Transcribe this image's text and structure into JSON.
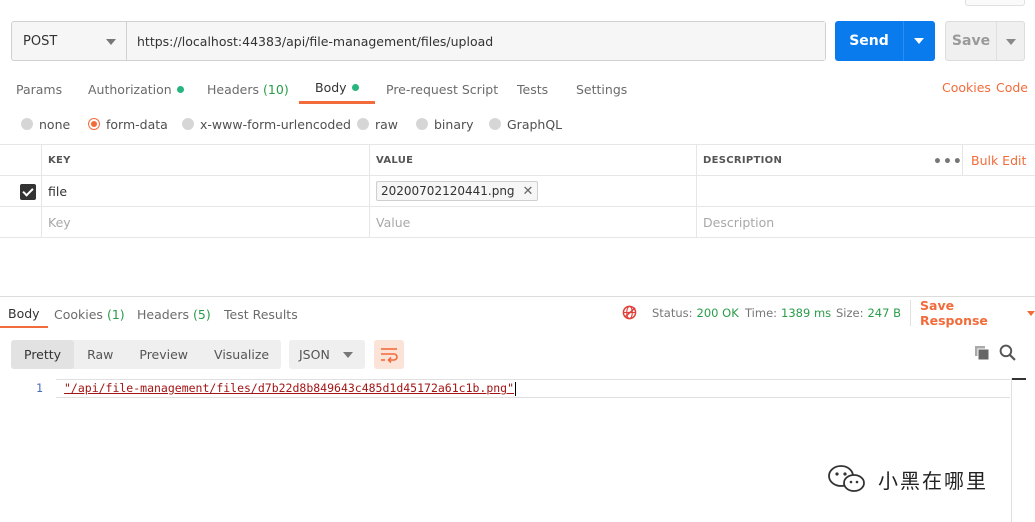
{
  "request": {
    "method": "POST",
    "url": "https://localhost:44383/api/file-management/files/upload",
    "send_label": "Send",
    "save_label": "Save"
  },
  "request_tabs": [
    {
      "label": "Params"
    },
    {
      "label": "Authorization"
    },
    {
      "label": "Headers",
      "count": "(10)"
    },
    {
      "label": "Body"
    },
    {
      "label": "Pre-request Script"
    },
    {
      "label": "Tests"
    },
    {
      "label": "Settings"
    }
  ],
  "links": {
    "cookies": "Cookies",
    "code": "Code"
  },
  "body_types": [
    "none",
    "form-data",
    "x-www-form-urlencoded",
    "raw",
    "binary",
    "GraphQL"
  ],
  "body_type_selected": "form-data",
  "params_table": {
    "headers": {
      "key": "KEY",
      "value": "VALUE",
      "description": "DESCRIPTION",
      "bulk_edit": "Bulk Edit"
    },
    "rows": [
      {
        "key": "file",
        "value": "20200702120441.png"
      }
    ],
    "placeholders": {
      "key": "Key",
      "value": "Value",
      "description": "Description"
    }
  },
  "response_tabs": [
    {
      "label": "Body"
    },
    {
      "label": "Cookies",
      "count": "(1)"
    },
    {
      "label": "Headers",
      "count": "(5)"
    },
    {
      "label": "Test Results"
    }
  ],
  "response_status": {
    "status_label": "Status:",
    "status_value": "200 OK",
    "time_label": "Time:",
    "time_value": "1389 ms",
    "size_label": "Size:",
    "size_value": "247 B",
    "save_response": "Save Response"
  },
  "view_tabs": [
    "Pretty",
    "Raw",
    "Preview",
    "Visualize"
  ],
  "format": "JSON",
  "editor": {
    "line_number": "1",
    "content": "\"/api/file-management/files/d7b22d8b849643c485d1d45172a61c1b.png\""
  },
  "watermark": "小黑在哪里",
  "colors": {
    "accent": "#f26b3a",
    "send": "#097bed",
    "success": "#2a9d4a"
  }
}
